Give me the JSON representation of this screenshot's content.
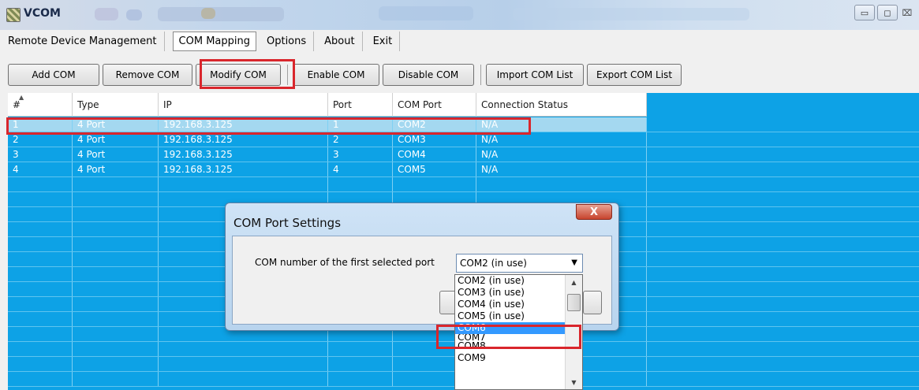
{
  "window": {
    "title": "VCOM",
    "buttons": [
      "▭",
      "◻",
      "⌧"
    ]
  },
  "menu": [
    "Remote Device Management",
    "COM Mapping",
    "Options",
    "About",
    "Exit"
  ],
  "toolbar": {
    "add": "Add COM",
    "remove": "Remove COM",
    "modify": "Modify COM",
    "enable": "Enable COM",
    "disable": "Disable COM",
    "import": "Import COM List",
    "export": "Export COM List"
  },
  "table": {
    "columns": [
      "#",
      "Type",
      "IP",
      "Port",
      "COM Port",
      "Connection Status"
    ],
    "rows": [
      [
        "1",
        "4 Port",
        "192.168.3.125",
        "1",
        "COM2",
        "N/A"
      ],
      [
        "2",
        "4 Port",
        "192.168.3.125",
        "2",
        "COM3",
        "N/A"
      ],
      [
        "3",
        "4 Port",
        "192.168.3.125",
        "3",
        "COM4",
        "N/A"
      ],
      [
        "4",
        "4 Port",
        "192.168.3.125",
        "4",
        "COM5",
        "N/A"
      ]
    ],
    "selected_row": 0
  },
  "dialog": {
    "title": "COM Port Settings",
    "close": "X",
    "label": "COM number of the first selected port",
    "selected": "COM2  (in use)",
    "options": [
      "COM2  (in use)",
      "COM3  (in use)",
      "COM4  (in use)",
      "COM5  (in use)",
      "COM6",
      "COM7",
      "COM8",
      "COM9"
    ],
    "highlighted_option": "COM6"
  },
  "colors": {
    "grid_background": "#0da2e6",
    "selection": "#3399ff",
    "highlight_box": "#d9262c"
  }
}
